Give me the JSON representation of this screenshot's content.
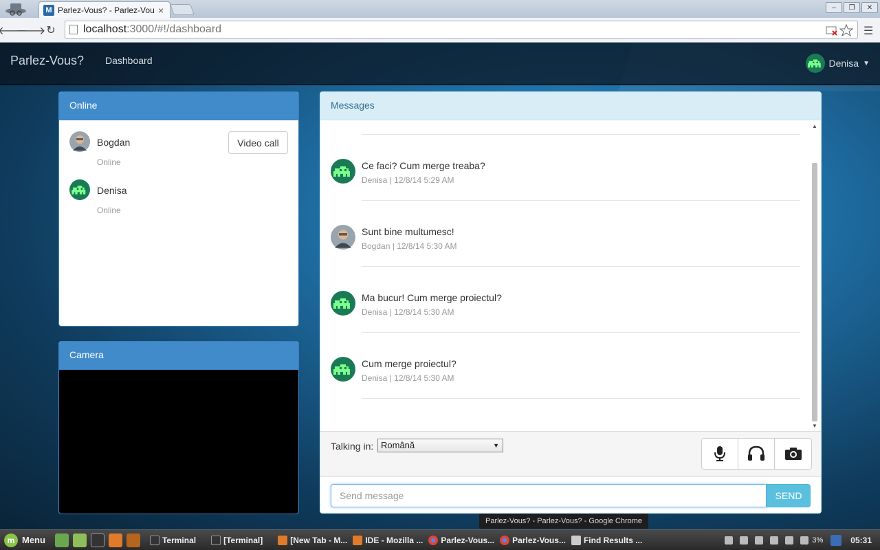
{
  "browser": {
    "tab_title": "Parlez-Vous? - Parlez-Vou",
    "tab_favicon_letter": "M",
    "url_host": "localhost",
    "url_rest": ":3000/#!/dashboard",
    "tab_close": "×"
  },
  "navbar": {
    "brand": "Parlez-Vous?",
    "dashboard_link": "Dashboard",
    "user_name": "Denisa"
  },
  "online": {
    "title": "Online",
    "video_call_label": "Video call",
    "contacts": [
      {
        "name": "Bogdan",
        "status": "Online"
      },
      {
        "name": "Denisa",
        "status": "Online"
      }
    ]
  },
  "camera": {
    "title": "Camera"
  },
  "messages": {
    "title": "Messages",
    "items": [
      {
        "text": "Ce faci? Cum merge treaba?",
        "meta": "Denisa | 12/8/14 5:29 AM",
        "author": "Denisa"
      },
      {
        "text": "Sunt bine multumesc!",
        "meta": "Bogdan | 12/8/14 5:30 AM",
        "author": "Bogdan"
      },
      {
        "text": "Ma bucur! Cum merge proiectul?",
        "meta": "Denisa | 12/8/14 5:30 AM",
        "author": "Denisa"
      },
      {
        "text": "Cum merge proiectul?",
        "meta": "Denisa | 12/8/14 5:30 AM",
        "author": "Denisa"
      }
    ],
    "talking_in_label": "Talking in:",
    "language": "Română",
    "send_placeholder": "Send message",
    "send_label": "SEND"
  },
  "tooltip": "Parlez-Vous? - Parlez-Vous? - Google Chrome",
  "taskbar": {
    "menu_label": "Menu",
    "items": [
      "Terminal",
      "[Terminal]",
      "[New Tab - M...",
      "IDE - Mozilla ...",
      "Parlez-Vous...",
      "Parlez-Vous...",
      "Find Results ..."
    ],
    "battery": "3%",
    "clock": "05:31"
  },
  "colors": {
    "primary_heading": "#428bca",
    "info_heading": "#d9edf7",
    "send_button": "#5bc0de",
    "avatar_green": "#1a7a55",
    "invader_green": "#7cff8a"
  }
}
